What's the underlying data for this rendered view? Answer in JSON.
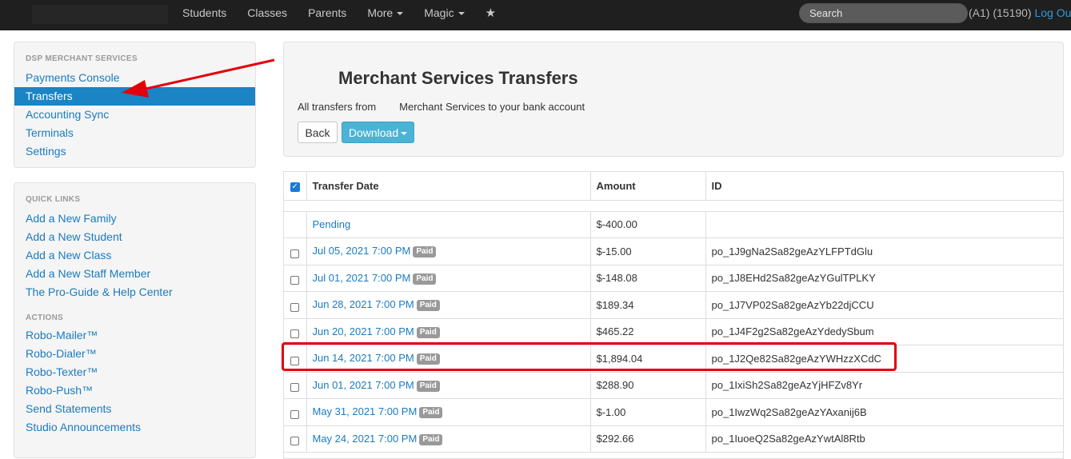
{
  "navbar": {
    "items": [
      {
        "label": "Students"
      },
      {
        "label": "Classes"
      },
      {
        "label": "Parents"
      },
      {
        "label": "More"
      },
      {
        "label": "Magic"
      }
    ],
    "favorites_icon": "star-icon",
    "search_placeholder": "Search",
    "account_info": "(A1) (15190)",
    "logout_label": "Log Out"
  },
  "sidebar": {
    "merchant": {
      "heading": "DSP MERCHANT SERVICES",
      "items": [
        {
          "label": "Payments Console"
        },
        {
          "label": "Transfers",
          "active": true
        },
        {
          "label": "Accounting Sync"
        },
        {
          "label": "Terminals"
        },
        {
          "label": "Settings"
        }
      ]
    },
    "quick_links": {
      "heading": "QUICK LINKS",
      "items": [
        {
          "label": "Add a New Family"
        },
        {
          "label": "Add a New Student"
        },
        {
          "label": "Add a New Class"
        },
        {
          "label": "Add a New Staff Member"
        },
        {
          "label": "The Pro-Guide & Help Center"
        }
      ]
    },
    "actions": {
      "heading": "ACTIONS",
      "items": [
        {
          "label": "Robo-Mailer™"
        },
        {
          "label": "Robo-Dialer™"
        },
        {
          "label": "Robo-Texter™"
        },
        {
          "label": "Robo-Push™"
        },
        {
          "label": "Send Statements"
        },
        {
          "label": "Studio Announcements"
        }
      ]
    }
  },
  "page": {
    "title": "Merchant Services Transfers",
    "subtitle": "All transfers from        Merchant Services to your bank account",
    "back_label": "Back",
    "download_label": "Download"
  },
  "table": {
    "headers": {
      "date": "Transfer Date",
      "amount": "Amount",
      "id": "ID"
    },
    "rows": [
      {
        "date": "Pending",
        "paid": false,
        "amount": "$-400.00",
        "id": "",
        "checkbox": false
      },
      {
        "date": "Jul 05, 2021 7:00 PM",
        "paid": true,
        "amount": "$-15.00",
        "id": "po_1J9gNa2Sa82geAzYLFPTdGlu",
        "checkbox": true
      },
      {
        "date": "Jul 01, 2021 7:00 PM",
        "paid": true,
        "amount": "$-148.08",
        "id": "po_1J8EHd2Sa82geAzYGulTPLKY",
        "checkbox": true
      },
      {
        "date": "Jun 28, 2021 7:00 PM",
        "paid": true,
        "amount": "$189.34",
        "id": "po_1J7VP02Sa82geAzYb22djCCU",
        "checkbox": true
      },
      {
        "date": "Jun 20, 2021 7:00 PM",
        "paid": true,
        "amount": "$465.22",
        "id": "po_1J4F2g2Sa82geAzYdedySbum",
        "checkbox": true
      },
      {
        "date": "Jun 14, 2021 7:00 PM",
        "paid": true,
        "amount": "$1,894.04",
        "id": "po_1J2Qe82Sa82geAzYWHzzXCdC",
        "checkbox": true,
        "highlighted": true
      },
      {
        "date": "Jun 01, 2021 7:00 PM",
        "paid": true,
        "amount": "$288.90",
        "id": "po_1IxiSh2Sa82geAzYjHFZv8Yr",
        "checkbox": true
      },
      {
        "date": "May 31, 2021 7:00 PM",
        "paid": true,
        "amount": "$-1.00",
        "id": "po_1IwzWq2Sa82geAzYAxanij6B",
        "checkbox": true
      },
      {
        "date": "May 24, 2021 7:00 PM",
        "paid": true,
        "amount": "$292.66",
        "id": "po_1IuoeQ2Sa82geAzYwtAl8Rtb",
        "checkbox": true
      }
    ],
    "paid_badge": "Paid"
  },
  "colors": {
    "navbar_bg": "#1f1f1f",
    "link": "#1a7bbf",
    "active_nav": "#1a84c4",
    "download_button": "#4ab3d6",
    "annotation_red": "#e3000b"
  }
}
